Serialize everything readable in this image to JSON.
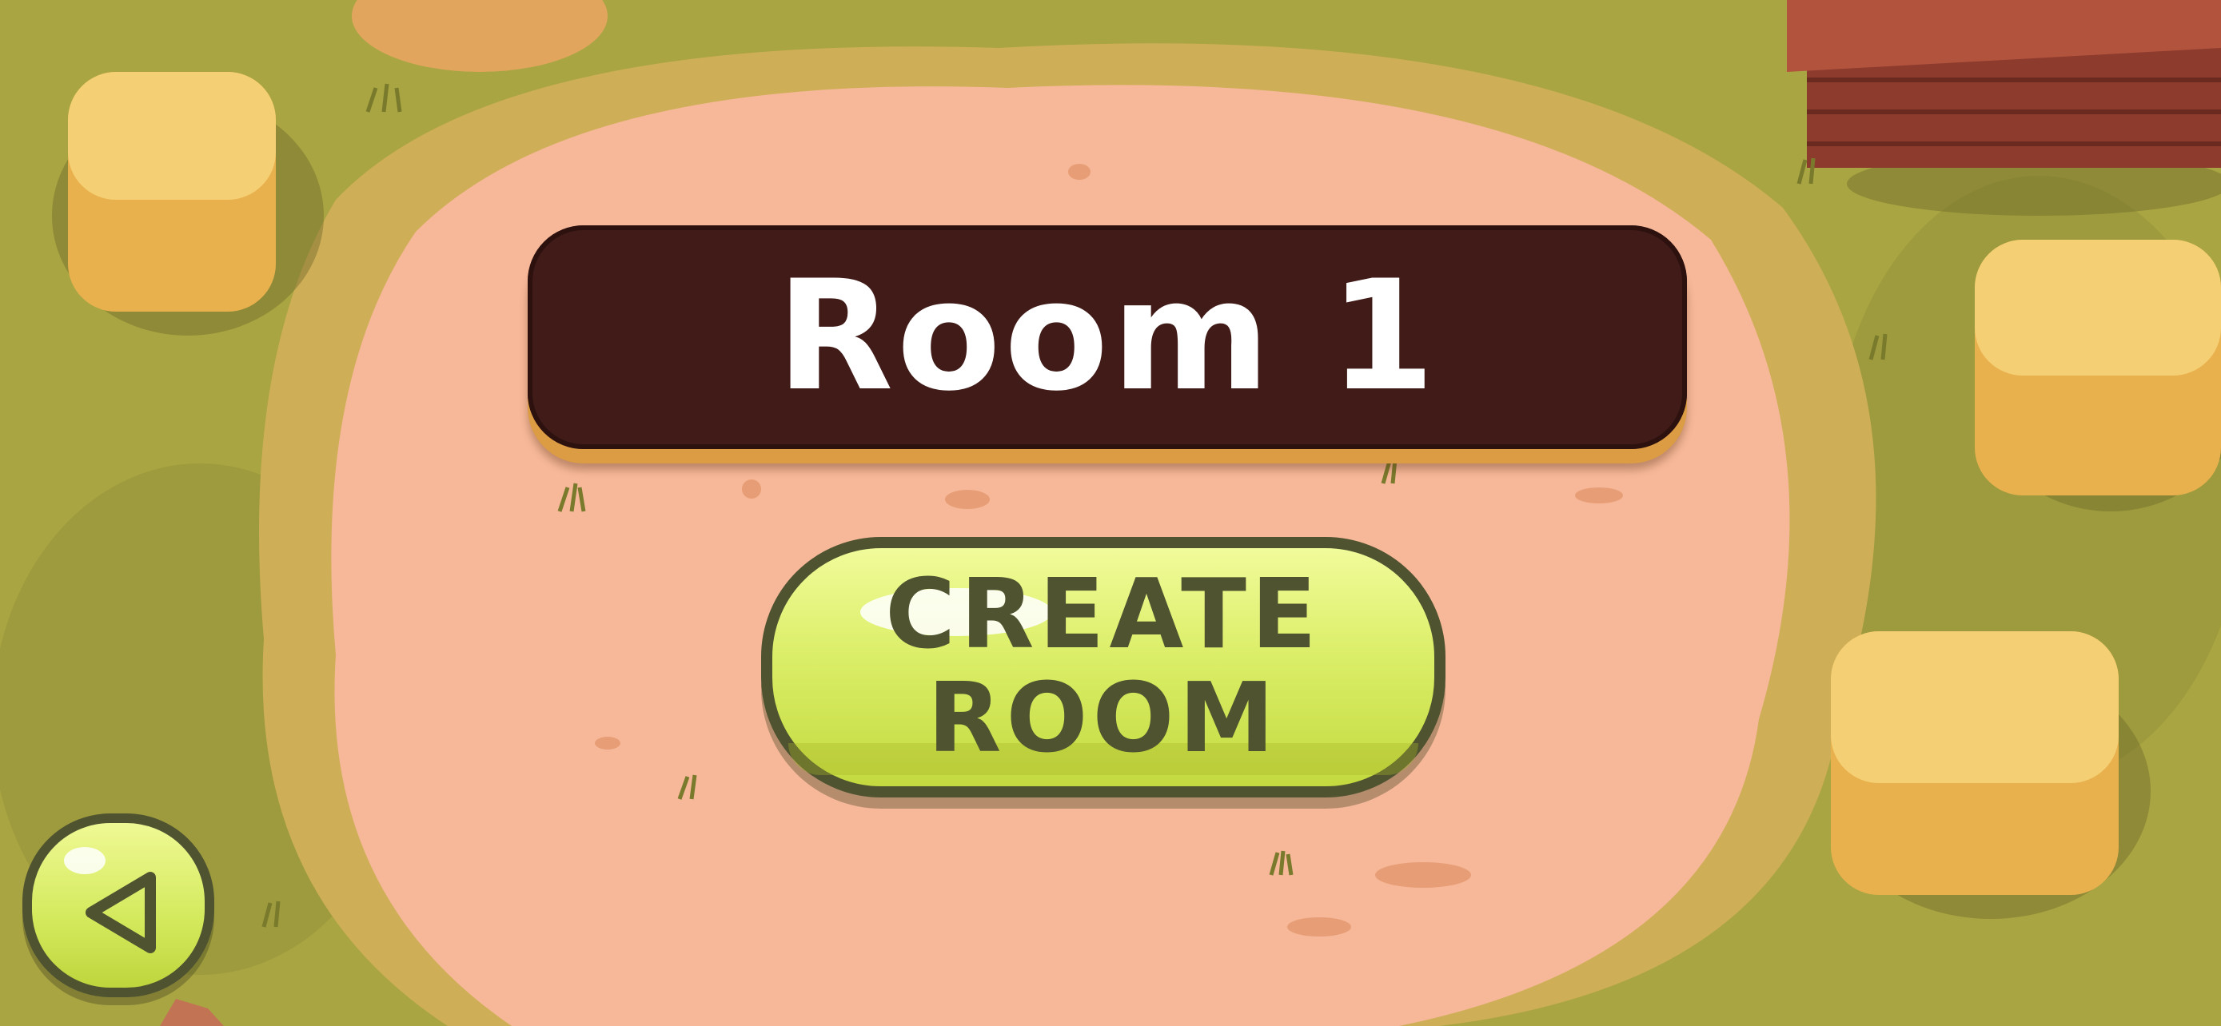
{
  "room": {
    "title": "Room 1"
  },
  "create_button": {
    "line1": "CREATE",
    "line2": "ROOM"
  },
  "back_button": {
    "icon": "back-arrow-icon"
  },
  "colors": {
    "banner_bg": "#411b18",
    "banner_trim": "#dc9c43",
    "button_green": "#dbee68",
    "button_outline": "#4f5330",
    "dirt": "#f6b898",
    "grass": "#a9a542"
  }
}
